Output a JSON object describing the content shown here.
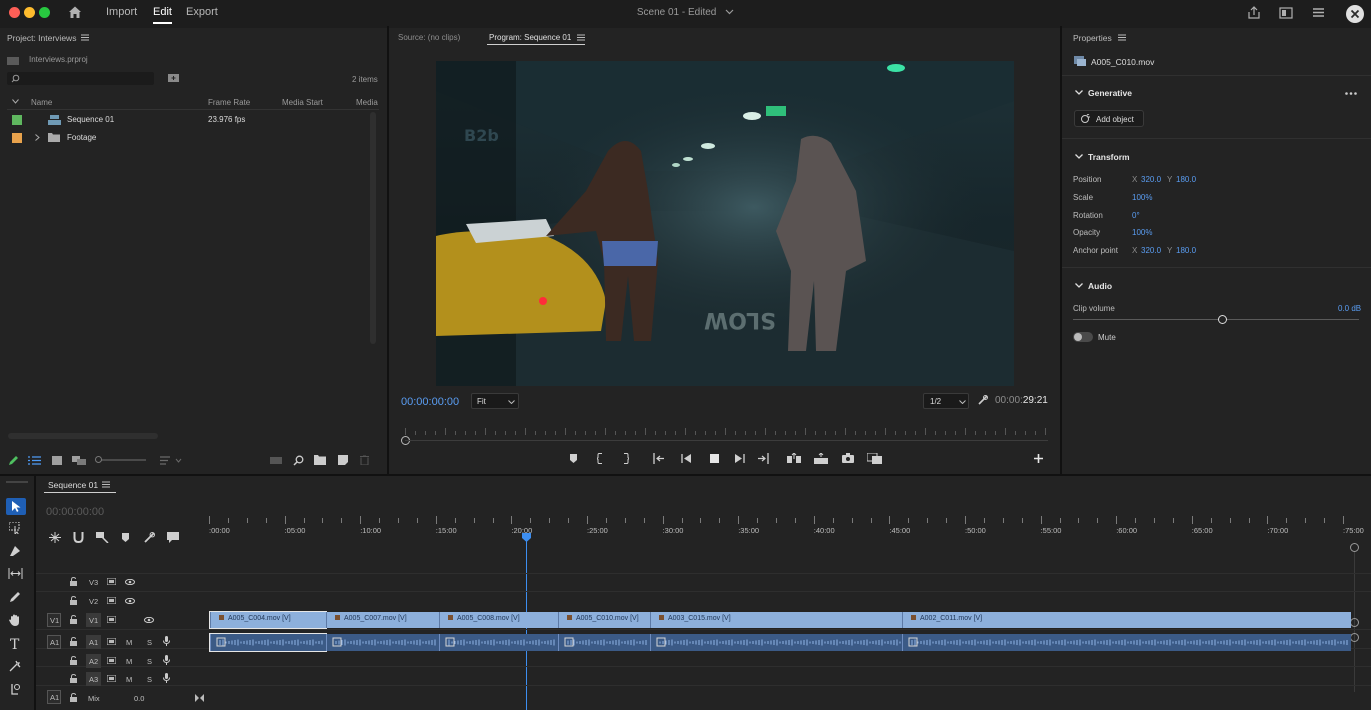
{
  "window": {
    "menu": [
      "Import",
      "Edit",
      "Export"
    ],
    "active_menu": "Edit",
    "title": "Scene 01 - Edited"
  },
  "project": {
    "header": "Project: Interviews",
    "file": "Interviews.prproj",
    "search_placeholder": "",
    "items_count": "2 items",
    "columns": [
      "Name",
      "Frame Rate",
      "Media Start",
      "Media"
    ],
    "rows": [
      {
        "name": "Sequence 01",
        "frame_rate": "23.976 fps",
        "color": "#5fb75f"
      },
      {
        "name": "Footage",
        "frame_rate": "",
        "color": "#e8a24c"
      }
    ]
  },
  "source_tab": "Source: (no clips)",
  "program": {
    "tab": "Program: Sequence 01",
    "timecode": "00:00:00:00",
    "fit": "Fit",
    "resolution": "1/2",
    "duration_prefix": "00:00:",
    "duration_suffix": "29:21"
  },
  "properties": {
    "header": "Properties",
    "clip": "A005_C010.mov",
    "generative": {
      "label": "Generative",
      "add_object": "Add object"
    },
    "transform": {
      "label": "Transform",
      "position": {
        "label": "Position",
        "x": "320.0",
        "y": "180.0"
      },
      "scale": {
        "label": "Scale",
        "value": "100%"
      },
      "rotation": {
        "label": "Rotation",
        "value": "0°"
      },
      "opacity": {
        "label": "Opacity",
        "value": "100%"
      },
      "anchor": {
        "label": "Anchor point",
        "x": "320.0",
        "y": "180.0"
      }
    },
    "audio": {
      "label": "Audio",
      "clip_volume": "Clip volume",
      "volume_value": "0.0 dB",
      "mute": "Mute"
    }
  },
  "timeline": {
    "tab": "Sequence 01",
    "timecode": "00:00:00:00",
    "ruler": [
      ":00:00",
      ":05:00",
      ":10:00",
      ":15:00",
      ":20:00",
      ":25:00",
      ":30:00",
      ":35:00",
      ":40:00",
      ":45:00",
      ":50:00",
      ":55:00",
      ":60:00",
      ":65:00",
      ":70:00",
      ":75:00"
    ],
    "video_tracks": [
      "V3",
      "V2",
      "V1"
    ],
    "audio_tracks": [
      "A1",
      "A2",
      "A3"
    ],
    "mix_label": "Mix",
    "mix_value": "0.0",
    "clips": [
      "A005_C004.mov [V]",
      "A005_C007.mov [V]",
      "A005_C008.mov [V]",
      "A005_C010.mov [V]",
      "A003_C015.mov [V]",
      "A002_C011.mov [V]"
    ],
    "track_buttons": {
      "mute": "M",
      "solo": "S",
      "x": "X"
    }
  },
  "colors": {
    "accent": "#3d8ef0",
    "clip_video": "#8db0dc",
    "clip_audio": "#3b5a86"
  }
}
